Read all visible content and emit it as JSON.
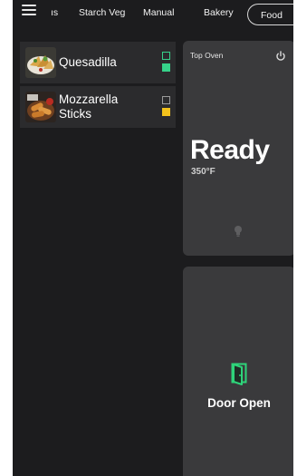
{
  "categories": [
    {
      "label": "ıs"
    },
    {
      "label": "Starch Veg"
    },
    {
      "label": "Manual"
    },
    {
      "label": "Bakery"
    },
    {
      "label": "Food",
      "active": true
    }
  ],
  "items": [
    {
      "name": "Quesadilla",
      "indicators": [
        "outline-green",
        "fill-green"
      ]
    },
    {
      "name": "Mozzarella Sticks",
      "name_line1": "Mozzarella",
      "name_line2": "Sticks",
      "indicators": [
        "outline",
        "fill-yellow"
      ]
    }
  ],
  "top_oven": {
    "title": "Top Oven",
    "status": "Ready",
    "temperature": "350°F"
  },
  "bottom_oven": {
    "status": "Door Open"
  },
  "colors": {
    "background": "#1c1c1e",
    "card": "#3a3a3c",
    "green": "#36d28a",
    "yellow": "#f3c21c"
  },
  "icons": [
    "hamburger-menu-icon",
    "power-icon",
    "lightbulb-icon",
    "door-open-icon"
  ]
}
